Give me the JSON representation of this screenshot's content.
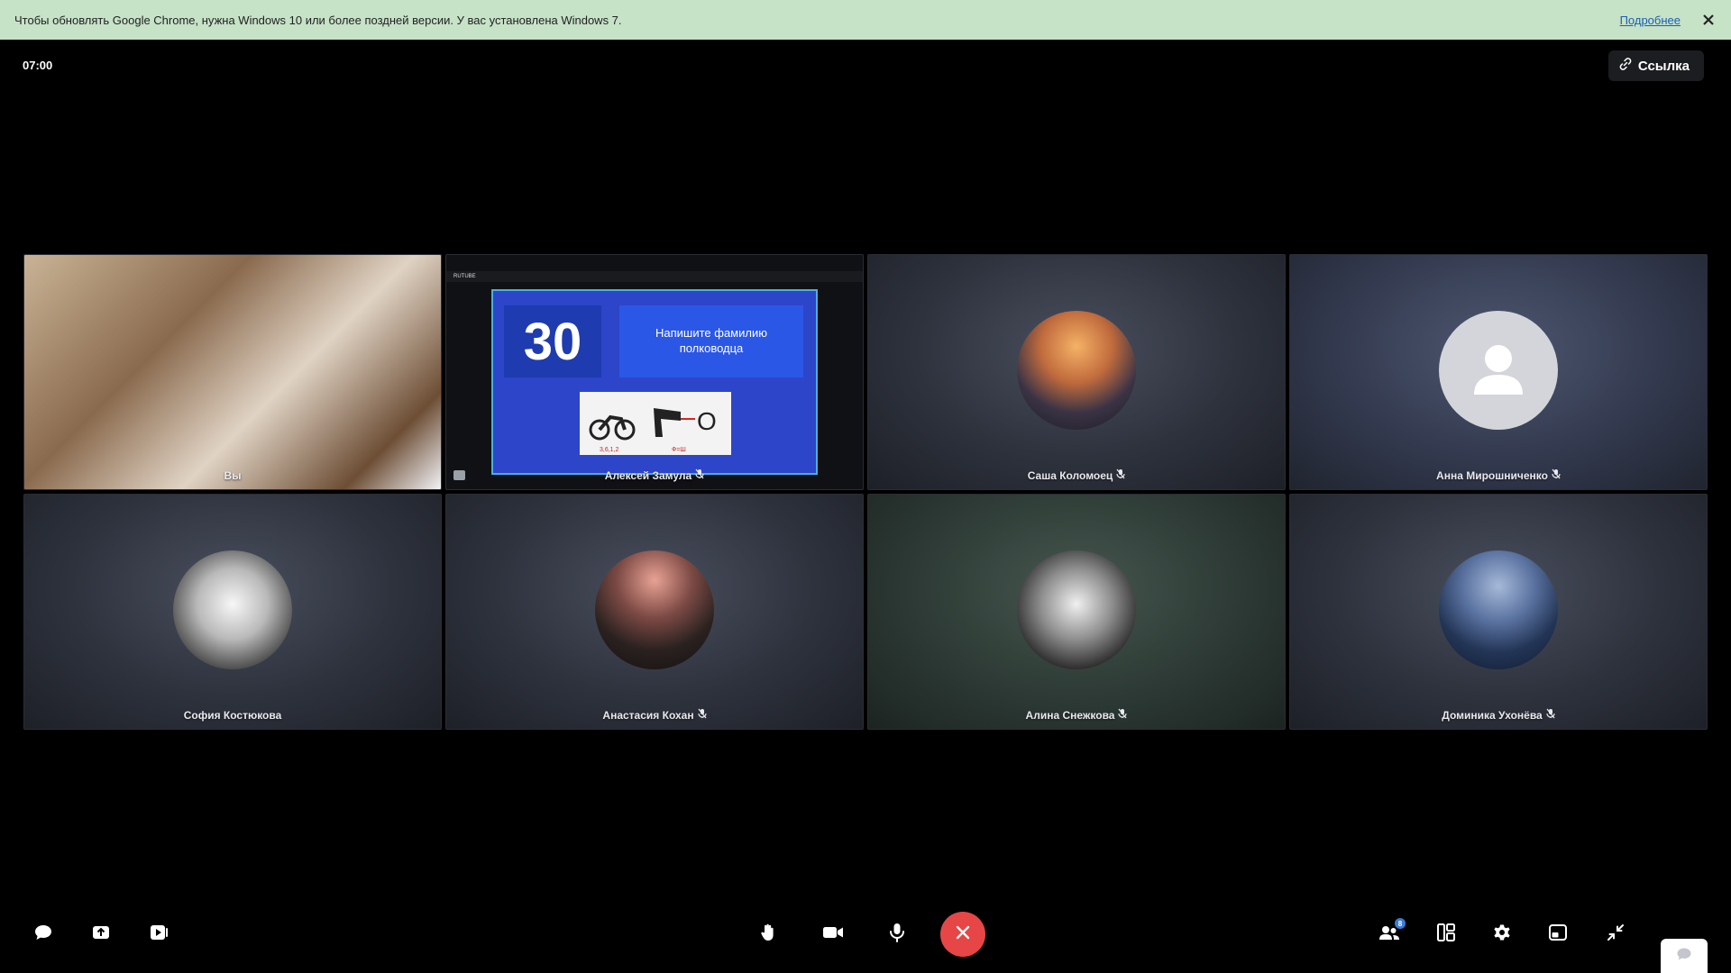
{
  "infobar": {
    "message": "Чтобы обновлять Google Chrome, нужна Windows 10 или более поздней версии. У вас установлена Windows 7.",
    "more_label": "Подробнее",
    "close_icon": "close-icon"
  },
  "call": {
    "timer": "07:00",
    "link_label": "Ссылка"
  },
  "participants": [
    {
      "name": "Вы",
      "type": "camera",
      "muted": false
    },
    {
      "name": "Алексей Замула",
      "type": "screen-share",
      "muted": true
    },
    {
      "name": "Саша Коломоец",
      "type": "avatar",
      "muted": true
    },
    {
      "name": "Анна Мирошниченко",
      "type": "default-avatar",
      "muted": true
    },
    {
      "name": "София Костюкова",
      "type": "avatar",
      "muted": false
    },
    {
      "name": "Анастасия Кохан",
      "type": "avatar",
      "muted": true
    },
    {
      "name": "Алина Снежкова",
      "type": "avatar",
      "muted": true
    },
    {
      "name": "Доминика Ухонёва",
      "type": "avatar",
      "muted": true
    }
  ],
  "screen_share": {
    "app_label": "RUTUBE",
    "slide_number": "30",
    "slide_question": "Напишите фамилию полководца",
    "slide_caption_left": "3,6,1,2",
    "slide_caption_right": "Ф=Ш",
    "slide_letter": "О"
  },
  "toolbar": {
    "participants_count": "8"
  },
  "colors": {
    "infobar_bg": "#c6e2c7",
    "end_call": "#e64646",
    "badge": "#3a7bd5"
  }
}
